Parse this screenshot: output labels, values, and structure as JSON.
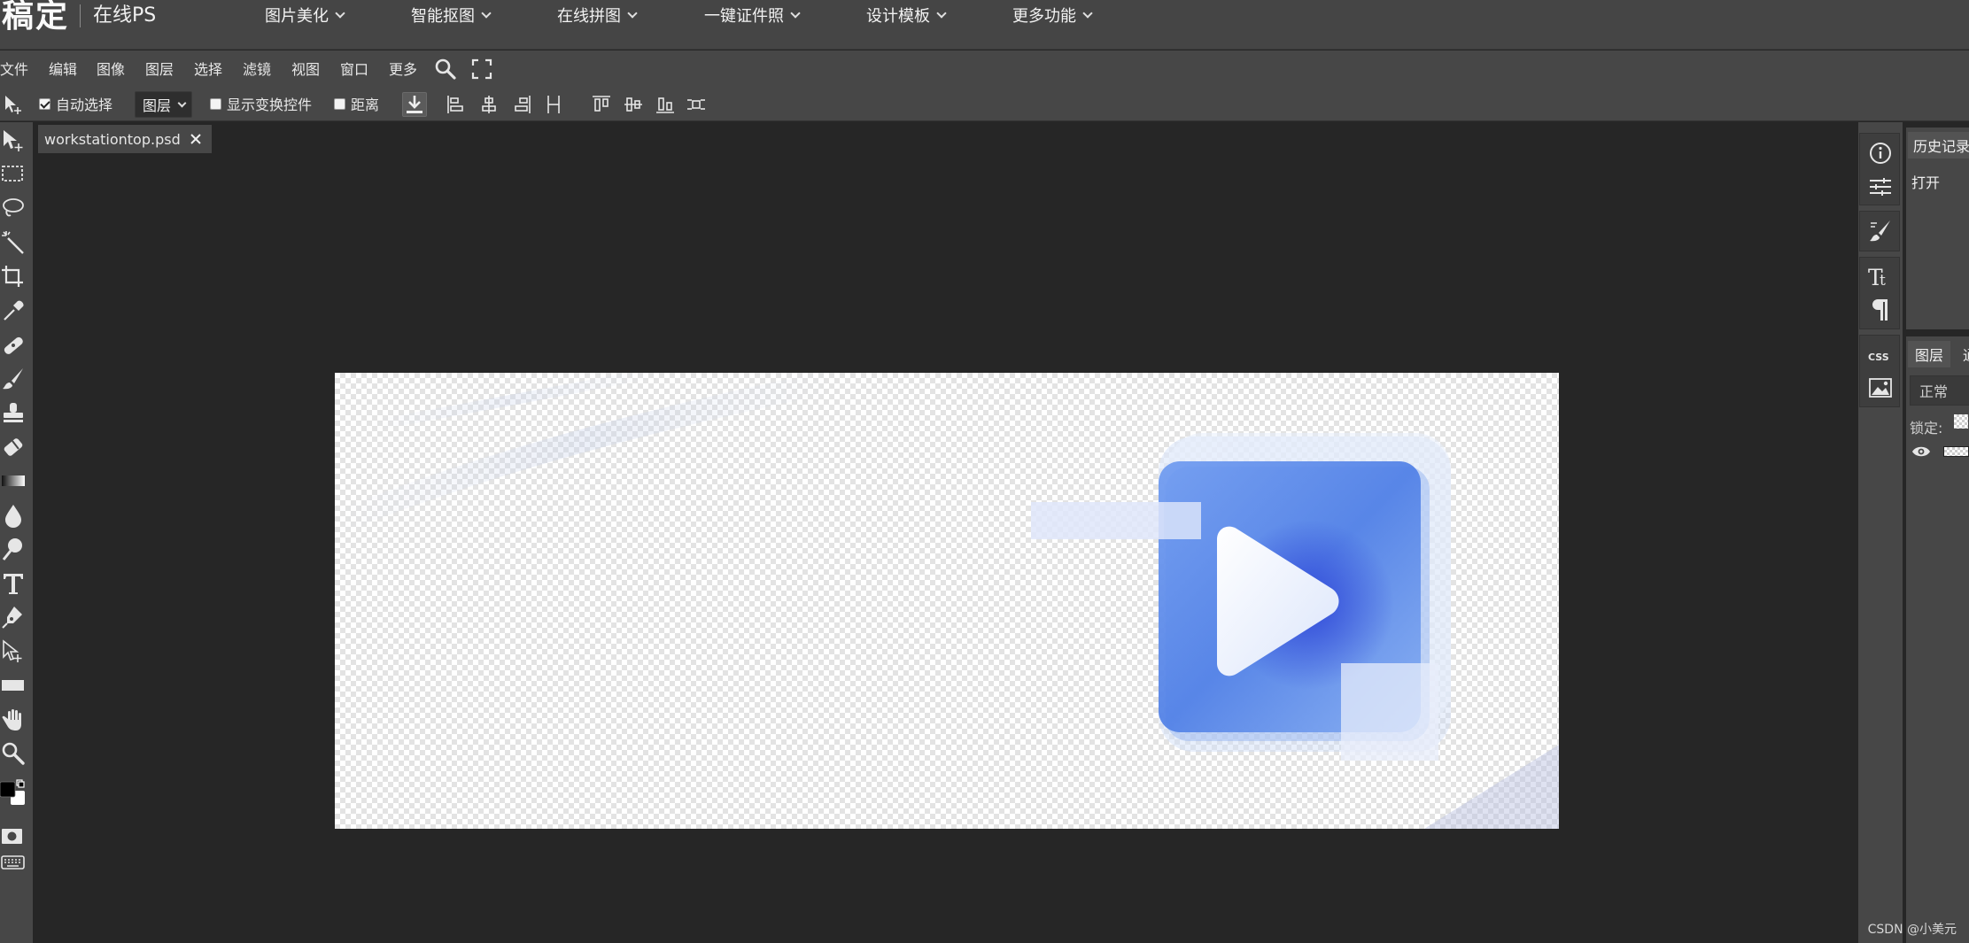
{
  "brand": {
    "logo": "稿定",
    "product": "在线PS"
  },
  "nav": [
    {
      "label": "图片美化"
    },
    {
      "label": "智能抠图"
    },
    {
      "label": "在线拼图"
    },
    {
      "label": "一键证件照"
    },
    {
      "label": "设计模板"
    },
    {
      "label": "更多功能"
    }
  ],
  "menu": [
    "文件",
    "编辑",
    "图像",
    "图层",
    "选择",
    "滤镜",
    "视图",
    "窗口",
    "更多"
  ],
  "options": {
    "auto_select_label": "自动选择",
    "auto_select_checked": true,
    "target_value": "图层",
    "show_transform_label": "显示变换控件",
    "show_transform_checked": false,
    "distance_label": "距离",
    "distance_checked": false
  },
  "document": {
    "tab_title": "workstationtop.psd"
  },
  "dock_toggle": "<>",
  "history_panel": {
    "tab": "历史记录",
    "rows": [
      "打开"
    ]
  },
  "layers_panel": {
    "tab": "图层",
    "tab2": "通",
    "blend_mode": "正常",
    "lock_label": "锁定:"
  },
  "watermark": "CSDN @小美元",
  "colors": {
    "foreground": "#000000",
    "background": "#ffffff",
    "ui_bg": "#474747",
    "canvas_area": "#262626"
  }
}
